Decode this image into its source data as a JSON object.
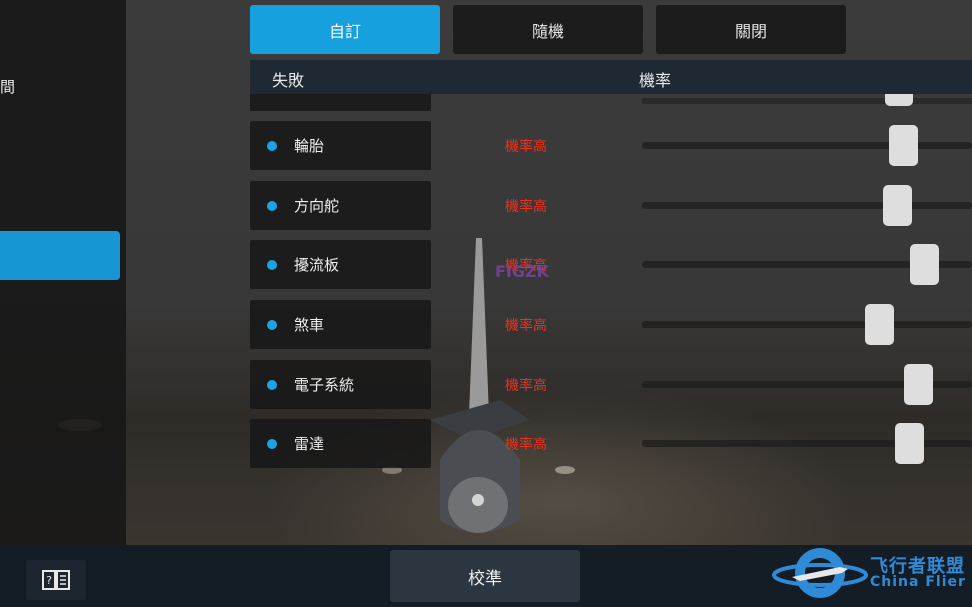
{
  "left_panel": {
    "partial_label": "間"
  },
  "tabs": [
    {
      "label": "自訂",
      "active": true
    },
    {
      "label": "隨機",
      "active": false
    },
    {
      "label": "關閉",
      "active": false
    }
  ],
  "table": {
    "headers": {
      "failure": "失敗",
      "probability": "機率"
    },
    "rows": [
      {
        "name": "輪胎",
        "status": "機率高",
        "slider_fraction": 0.82
      },
      {
        "name": "方向舵",
        "status": "機率高",
        "slider_fraction": 0.8
      },
      {
        "name": "擾流板",
        "status": "機率高",
        "slider_fraction": 0.89
      },
      {
        "name": "煞車",
        "status": "機率高",
        "slider_fraction": 0.74
      },
      {
        "name": "電子系統",
        "status": "機率高",
        "slider_fraction": 0.87
      },
      {
        "name": "雷達",
        "status": "機率高",
        "slider_fraction": 0.84
      }
    ]
  },
  "overlay_text": "FIGZK",
  "bottom_bar": {
    "manual_icon": "book-question-icon",
    "calibrate_label": "校準"
  },
  "watermark_logo": {
    "cn": "飞行者联盟",
    "en": "China Flier"
  },
  "colors": {
    "accent": "#17a0de",
    "status_red": "#e8321e",
    "logo_blue": "#2f8bd6"
  }
}
